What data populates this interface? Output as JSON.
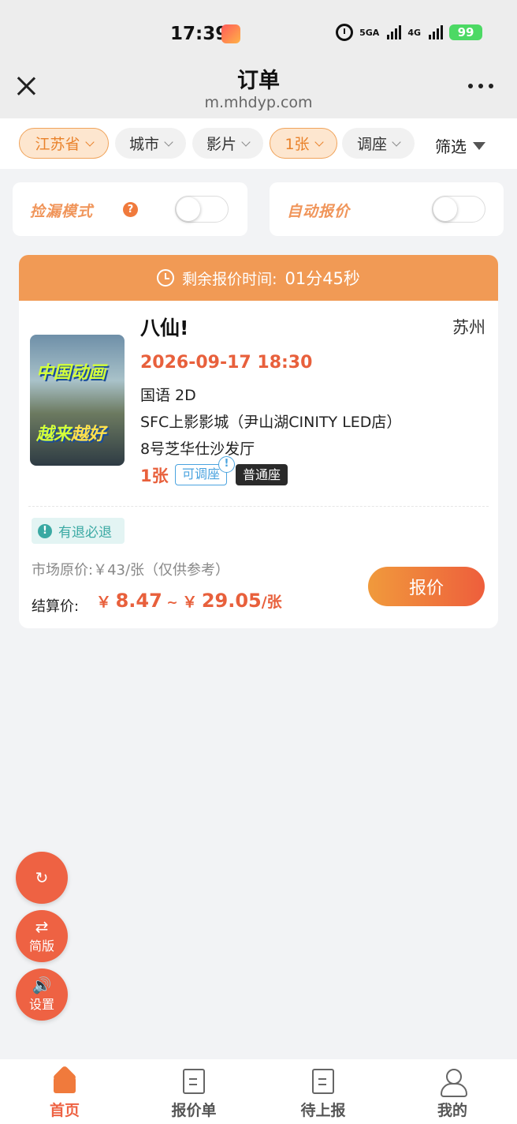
{
  "status_bar": {
    "time": "17:39",
    "network_5g": "5GA",
    "network_4g": "4G",
    "battery": "99"
  },
  "header": {
    "title": "订单",
    "url": "m.mhdyp.com"
  },
  "filters": {
    "province": "江苏省",
    "city": "城市",
    "movie": "影片",
    "tickets": "1张",
    "seat_adjust": "调座",
    "filter_label": "筛选"
  },
  "toggles": {
    "leak_mode": "捡漏模式",
    "leak_help": "?",
    "auto_quote": "自动报价"
  },
  "order": {
    "timer_label": "剩余报价时间:",
    "timer_value": "01分45秒",
    "poster_line1": "中国动画",
    "poster_line2a": "越来",
    "poster_line2b": "越好",
    "movie_title": "八仙!",
    "city": "苏州",
    "show_time": "2026-09-17 18:30",
    "language_format": "国语 2D",
    "cinema": "SFC上影影城（尹山湖CINITY LED店）",
    "hall": "8号芝华仕沙发厅",
    "quantity": "1张",
    "tag_adjust": "可调座",
    "tag_adjust_hint": "!",
    "tag_seat": "普通座",
    "refund_icon": "!",
    "refund_label": "有退必退",
    "market_price": "市场原价:￥43/张（仅供参考）",
    "settle_label": "结算价:",
    "settle_currency": "￥",
    "settle_min": "8.47",
    "settle_sep": "~",
    "settle_max": "29.05",
    "settle_unit": "/张",
    "quote_button": "报价"
  },
  "fabs": {
    "refresh_icon": "↻",
    "simple_icon": "⇄",
    "simple_label": "简版",
    "settings_icon": "🔊",
    "settings_label": "设置"
  },
  "bottom_nav": [
    {
      "label": "首页",
      "active": true
    },
    {
      "label": "报价单",
      "active": false
    },
    {
      "label": "待上报",
      "active": false
    },
    {
      "label": "我的",
      "active": false
    }
  ],
  "colors": {
    "accent": "#ee6243",
    "orange": "#f19a55",
    "price_red": "#e8603c",
    "chip_active_bg": "#fde6cf"
  }
}
